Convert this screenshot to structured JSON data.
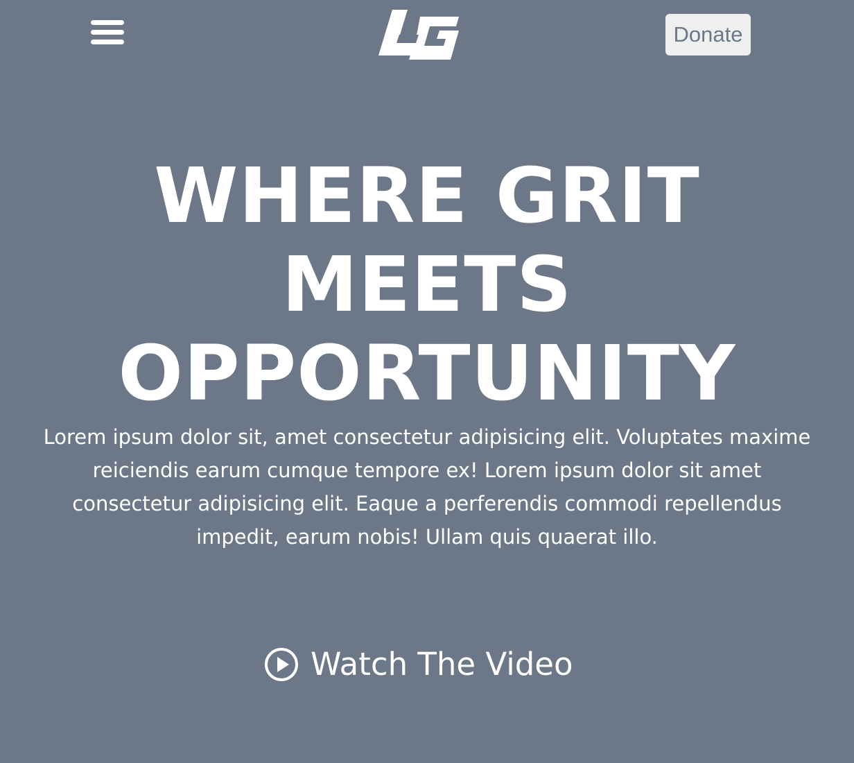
{
  "header": {
    "menu_icon": "hamburger-menu-icon",
    "logo_text": "LG",
    "donate_label": "Donate"
  },
  "hero": {
    "title_line1": "WHERE GRIT MEETS",
    "title_line2": "OPPORTUNITY",
    "paragraph": "Lorem ipsum dolor sit, amet consectetur adipisicing elit. Voluptates maxime reiciendis earum cumque tempore ex! Lorem ipsum dolor sit amet consectetur adipisicing elit. Eaque a perferendis commodi repellendus impedit, earum nobis! Ullam quis quaerat illo.",
    "video_icon": "play-circle-icon",
    "video_label": "Watch The Video"
  },
  "colors": {
    "background": "#6c7787",
    "text": "#ffffff",
    "button_bg": "#efefef",
    "button_text": "#6c7787"
  }
}
